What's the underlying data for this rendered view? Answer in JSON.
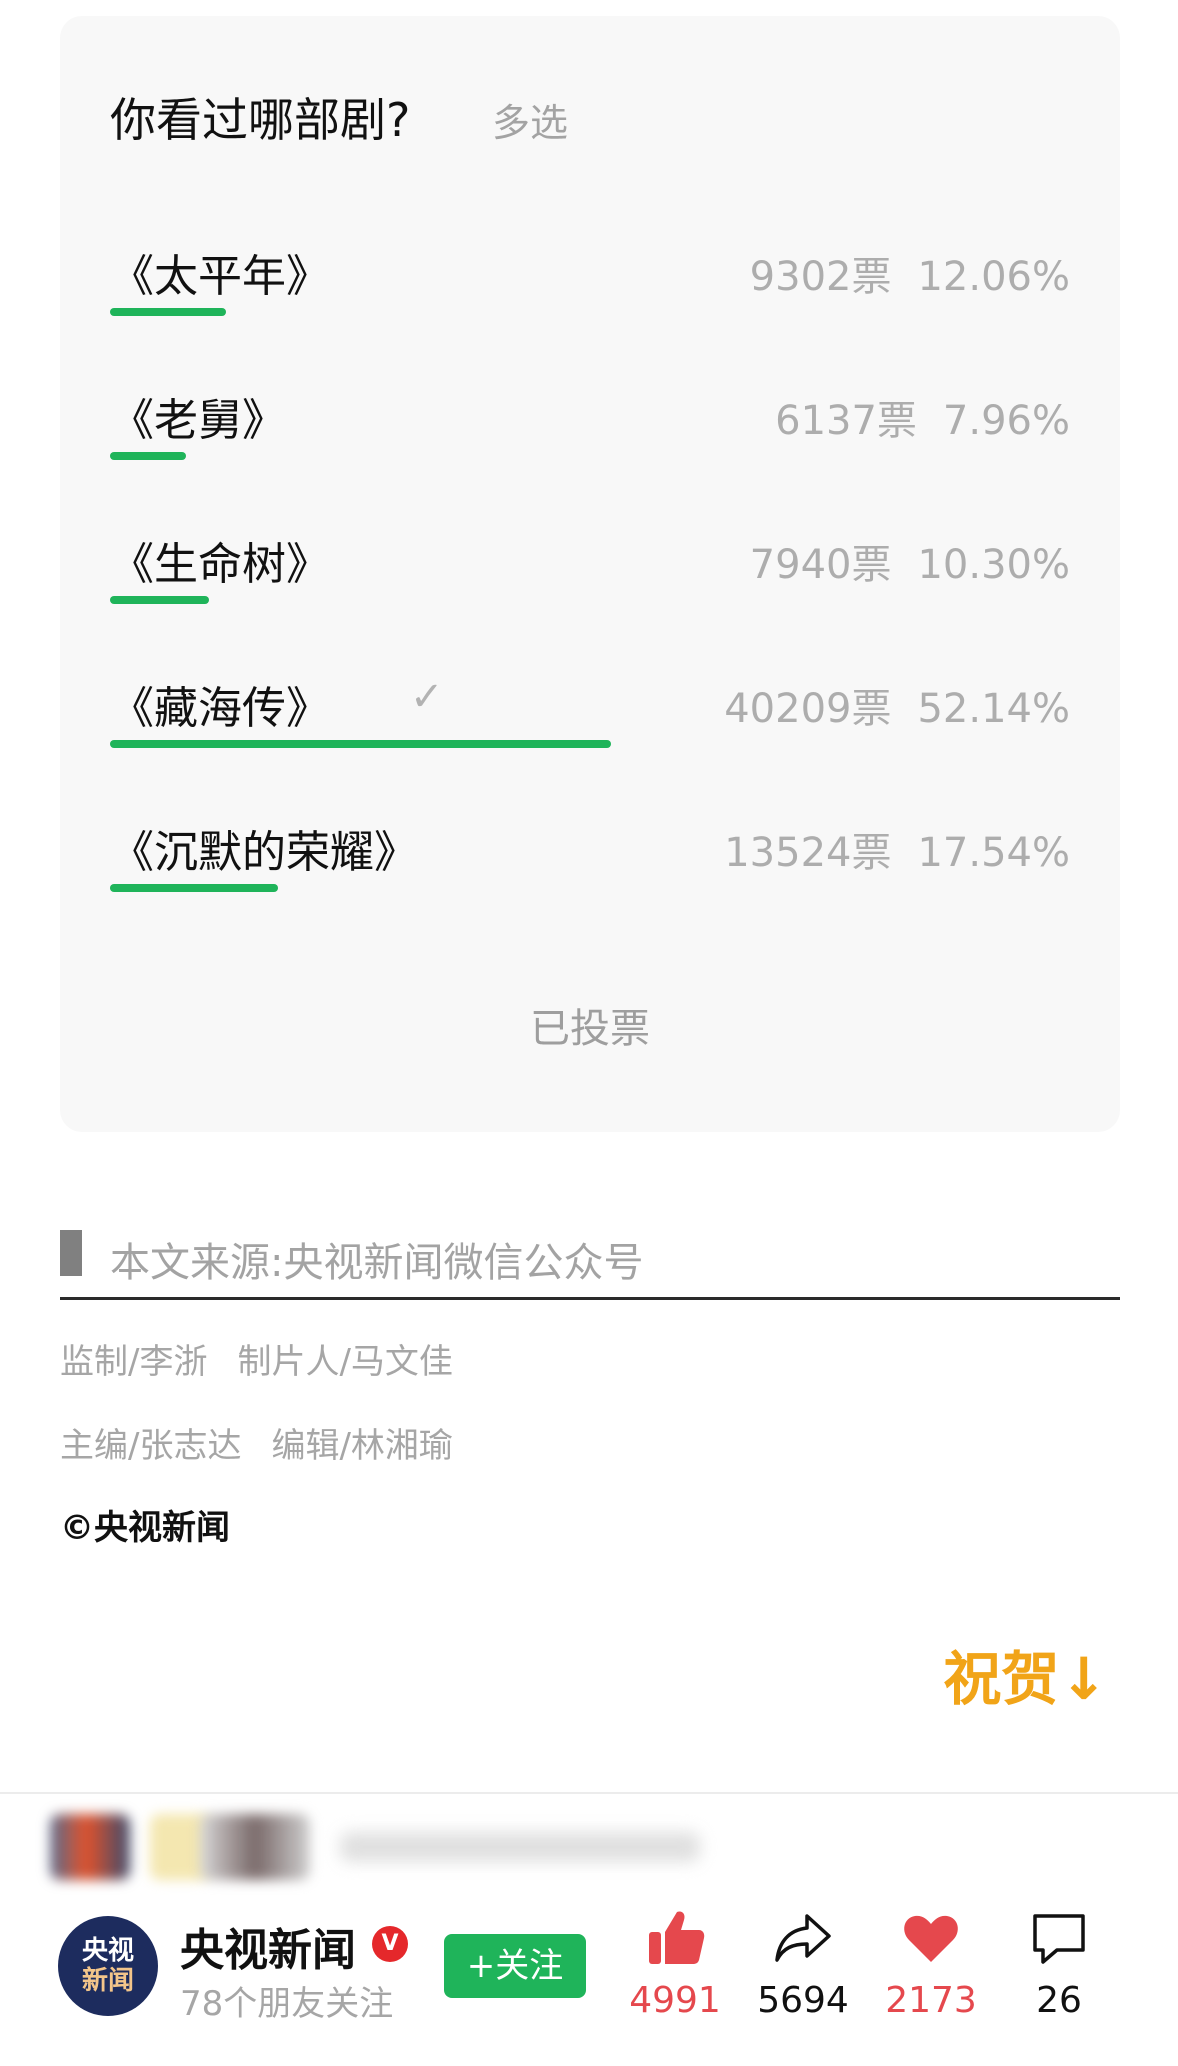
{
  "poll": {
    "title": "你看过哪部剧?",
    "mode": "多选",
    "options": [
      {
        "label": "《太平年》",
        "votes": "9302票",
        "percent": "12.06%",
        "fraction": 0.1206,
        "selected": false
      },
      {
        "label": "《老舅》",
        "votes": "6137票",
        "percent": "7.96%",
        "fraction": 0.0796,
        "selected": false
      },
      {
        "label": "《生命树》",
        "votes": "7940票",
        "percent": "10.30%",
        "fraction": 0.103,
        "selected": false
      },
      {
        "label": "《藏海传》",
        "votes": "40209票",
        "percent": "52.14%",
        "fraction": 0.5214,
        "selected": true,
        "check": "✓"
      },
      {
        "label": "《沉默的荣耀》",
        "votes": "13524票",
        "percent": "17.54%",
        "fraction": 0.1754,
        "selected": false
      }
    ],
    "status": "已投票",
    "bar_color": "#1fb45a"
  },
  "article": {
    "source": "本文来源:央视新闻微信公众号",
    "credits_line1": [
      "监制/李浙",
      "制片人/马文佳"
    ],
    "credits_line2": [
      "主编/张志达",
      "编辑/林湘瑜"
    ],
    "copyright": "©央视新闻",
    "congrats": "祝贺↓"
  },
  "footer": {
    "account": {
      "avatar_line1": "央视",
      "avatar_line2": "新闻",
      "name": "央视新闻",
      "badge": "V",
      "followers": "78个朋友关注",
      "follow_label": "+关注"
    },
    "actions": [
      {
        "icon": "thumbs-up-icon",
        "count": "4991",
        "color": "#e5484d"
      },
      {
        "icon": "share-icon",
        "count": "5694",
        "color": "#111111"
      },
      {
        "icon": "heart-icon",
        "count": "2173",
        "color": "#e5484d"
      },
      {
        "icon": "comment-icon",
        "count": "26",
        "color": "#111111"
      }
    ]
  }
}
